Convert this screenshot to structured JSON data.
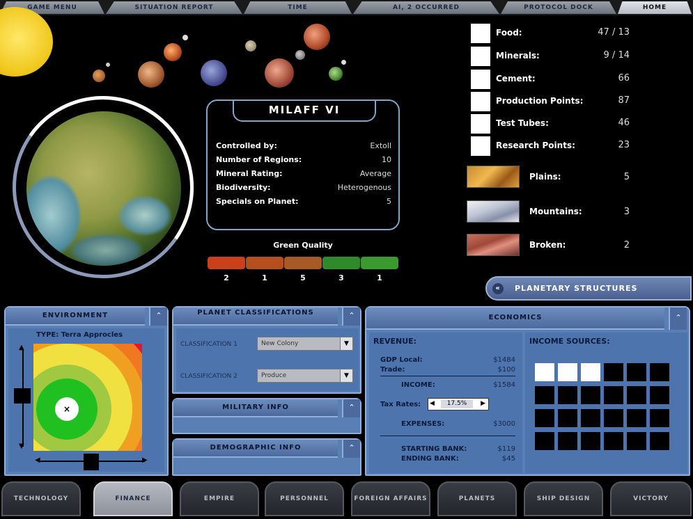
{
  "top_menu": [
    "GAME MENU",
    "SITUATION REPORT",
    "TIME",
    "AI, 2 OCCURRED",
    "PROTOCOL DOCK",
    "HOME"
  ],
  "planet": {
    "name": "MILAFF VI",
    "details": [
      {
        "key": "Controlled by:",
        "value": "Extoll"
      },
      {
        "key": "Number of Regions:",
        "value": "10"
      },
      {
        "key": "Mineral Rating:",
        "value": "Average"
      },
      {
        "key": "Biodiversity:",
        "value": "Heterogenous"
      },
      {
        "key": "Specials on Planet:",
        "value": "5"
      }
    ]
  },
  "green_quality": {
    "label": "Green Quality",
    "segments": [
      {
        "value": "2",
        "color": "#c9401a"
      },
      {
        "value": "1",
        "color": "#b5501e"
      },
      {
        "value": "5",
        "color": "#a85a24"
      },
      {
        "value": "3",
        "color": "#2f8a2a"
      },
      {
        "value": "1",
        "color": "#3a9a30"
      }
    ]
  },
  "resources": [
    {
      "label": "Food:",
      "value": "47 / 13"
    },
    {
      "label": "Minerals:",
      "value": "9 / 14"
    },
    {
      "label": "Cement:",
      "value": "66"
    },
    {
      "label": "Production Points:",
      "value": "87"
    },
    {
      "label": "Test Tubes:",
      "value": "46"
    },
    {
      "label": "Research Points:",
      "value": "23"
    }
  ],
  "terrain": [
    {
      "label": "Plains:",
      "value": "5"
    },
    {
      "label": "Mountains:",
      "value": "3"
    },
    {
      "label": "Broken:",
      "value": "2"
    }
  ],
  "planetary_structures": "PLANETARY STRUCTURES",
  "environment": {
    "title": "ENVIRONMENT",
    "type_label": "TYPE: Terra Approcles"
  },
  "classification": {
    "title": "PLANET CLASSIFICATIONS",
    "label1": "CLASSIFICATION 1",
    "value1": "New Colony",
    "label2": "CLASSIFICATION 2",
    "value2": "Produce"
  },
  "military": {
    "title": "MILITARY INFO"
  },
  "demographic": {
    "title": "DEMOGRAPHIC INFO"
  },
  "economics": {
    "title": "ECONOMICS",
    "revenue_label": "REVENUE:",
    "gdp_label": "GDP Local:",
    "gdp_value": "$1484",
    "trade_label": "Trade:",
    "trade_value": "$100",
    "income_label": "INCOME:",
    "income_value": "$1584",
    "tax_label": "Tax Rates:",
    "tax_value": "17.5%",
    "expenses_label": "EXPENSES:",
    "expenses_value": "$3000",
    "starting_label": "STARTING BANK:",
    "starting_value": "$119",
    "ending_label": "ENDING BANK:",
    "ending_value": "$45",
    "income_sources_label": "INCOME SOURCES:",
    "income_sources_filled": 3
  },
  "bottom_tabs": [
    "TECHNOLOGY",
    "FINANCE",
    "EMPIRE",
    "PERSONNEL",
    "FOREIGN AFFAIRS",
    "PLANETS",
    "SHIP DESIGN",
    "VICTORY"
  ],
  "active_tab": "FINANCE",
  "icons": {
    "panel_toggle": "chevron-up-icon",
    "structures": "chevron-left-icon",
    "dropdown": "chevron-down-icon"
  }
}
